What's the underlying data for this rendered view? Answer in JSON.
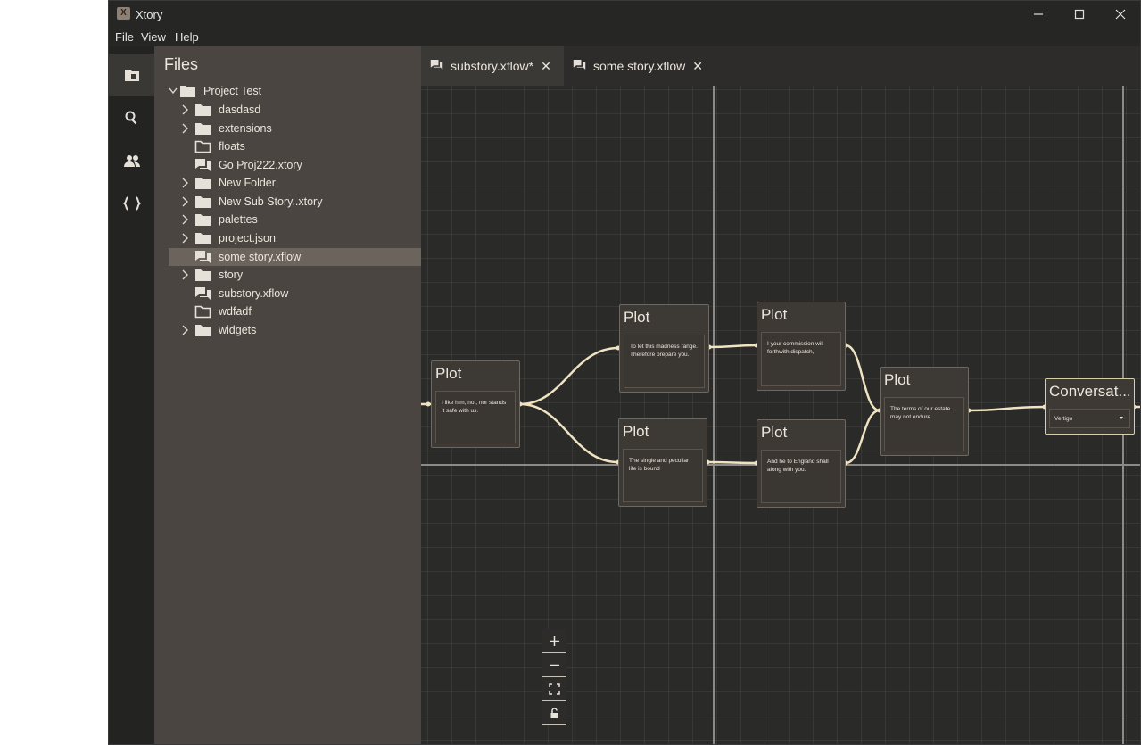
{
  "app": {
    "title": "Xtory",
    "logo_text": "X"
  },
  "menu": {
    "items": [
      "File",
      "View",
      "Help"
    ]
  },
  "activity_bar": {
    "icons": [
      "files-icon",
      "search-icon",
      "people-icon",
      "braces-icon"
    ]
  },
  "sidebar": {
    "title": "Files",
    "tree": [
      {
        "label": "Project Test",
        "type": "folder",
        "expanded": true
      },
      {
        "label": "dasdasd",
        "type": "folder"
      },
      {
        "label": "extensions",
        "type": "folder"
      },
      {
        "label": "floats",
        "type": "empty-folder"
      },
      {
        "label": "Go Proj222.xtory",
        "type": "story-file"
      },
      {
        "label": "New Folder",
        "type": "folder"
      },
      {
        "label": "New Sub Story..xtory",
        "type": "folder"
      },
      {
        "label": "palettes",
        "type": "folder"
      },
      {
        "label": "project.json",
        "type": "folder"
      },
      {
        "label": "some story.xflow",
        "type": "story-file",
        "selected": true
      },
      {
        "label": "story",
        "type": "folder"
      },
      {
        "label": "substory.xflow",
        "type": "story-file"
      },
      {
        "label": "wdfadf",
        "type": "empty-folder"
      },
      {
        "label": "widgets",
        "type": "folder"
      }
    ]
  },
  "tabs": [
    {
      "label": "substory.xflow*",
      "active": true
    },
    {
      "label": "some story.xflow",
      "active": false
    }
  ],
  "nodes": {
    "n1": {
      "title": "Plot",
      "text": "I like him, not, nor stands it safe with us."
    },
    "n2": {
      "title": "Plot",
      "text": "To let this madness range. Therefore prepare you."
    },
    "n3": {
      "title": "Plot",
      "text": "The single and peculiar life is bound"
    },
    "n4": {
      "title": "Plot",
      "text": "I your commission will forthwith dispatch,"
    },
    "n5": {
      "title": "Plot",
      "text": "And he to England shall along with you."
    },
    "n6": {
      "title": "Plot",
      "text": "The terms of our estate may not endure"
    },
    "n7": {
      "title": "Conversat...",
      "select": "Vertigo"
    }
  },
  "colors": {
    "accent": "#e8dcb8",
    "edge": "#efe3c1",
    "panel": "#4a4541",
    "canvas": "#2a2a29"
  }
}
